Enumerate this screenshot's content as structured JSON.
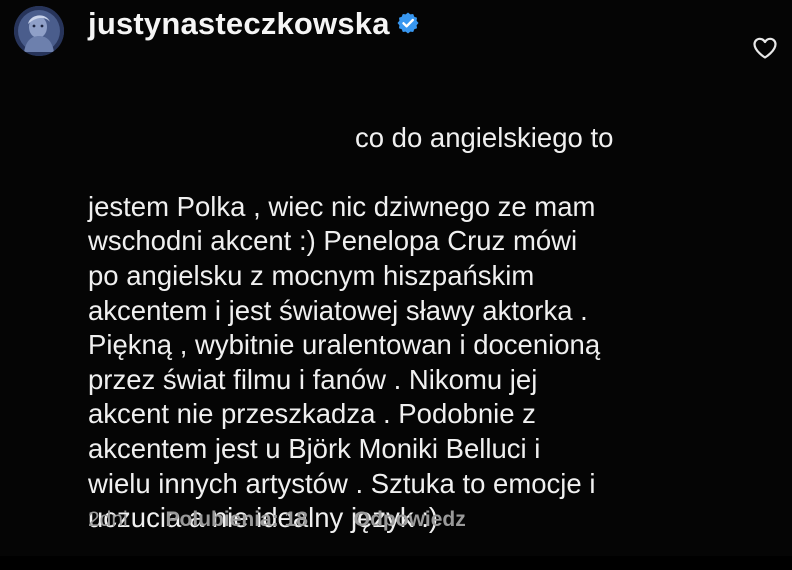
{
  "comment": {
    "username": "justynasteczkowska",
    "verified": true,
    "text_first_line": "co do angielskiego to",
    "text_rest": "jestem Polka , wiec nic dziwnego ze mam\nwschodni akcent :) Penelopa Cruz mówi\npo angielsku z mocnym hiszpańskim\nakcentem i jest światowej sławy aktorka .\nPiękną , wybitnie uralentowan i docenioną\nprzez świat filmu i fanów . Nikomu jej\nakcent nie przeszkadza . Podobnie z\nakcentem jest u Björk Moniki Belluci i\nwielu innych artystów . Sztuka to emocje i\nuczucia a nie idealny język :)",
    "time": "2dni",
    "likes_label": "Polubienia: 18",
    "reply_label": "Odpowiedz"
  },
  "icons": {
    "avatar": "profile-avatar",
    "verified": "verified-badge-icon",
    "like": "heart-outline-icon"
  },
  "colors": {
    "background": "#050505",
    "text": "#f0f0f0",
    "meta_text": "#9a9a9a",
    "verified_badge": "#3897f0"
  }
}
